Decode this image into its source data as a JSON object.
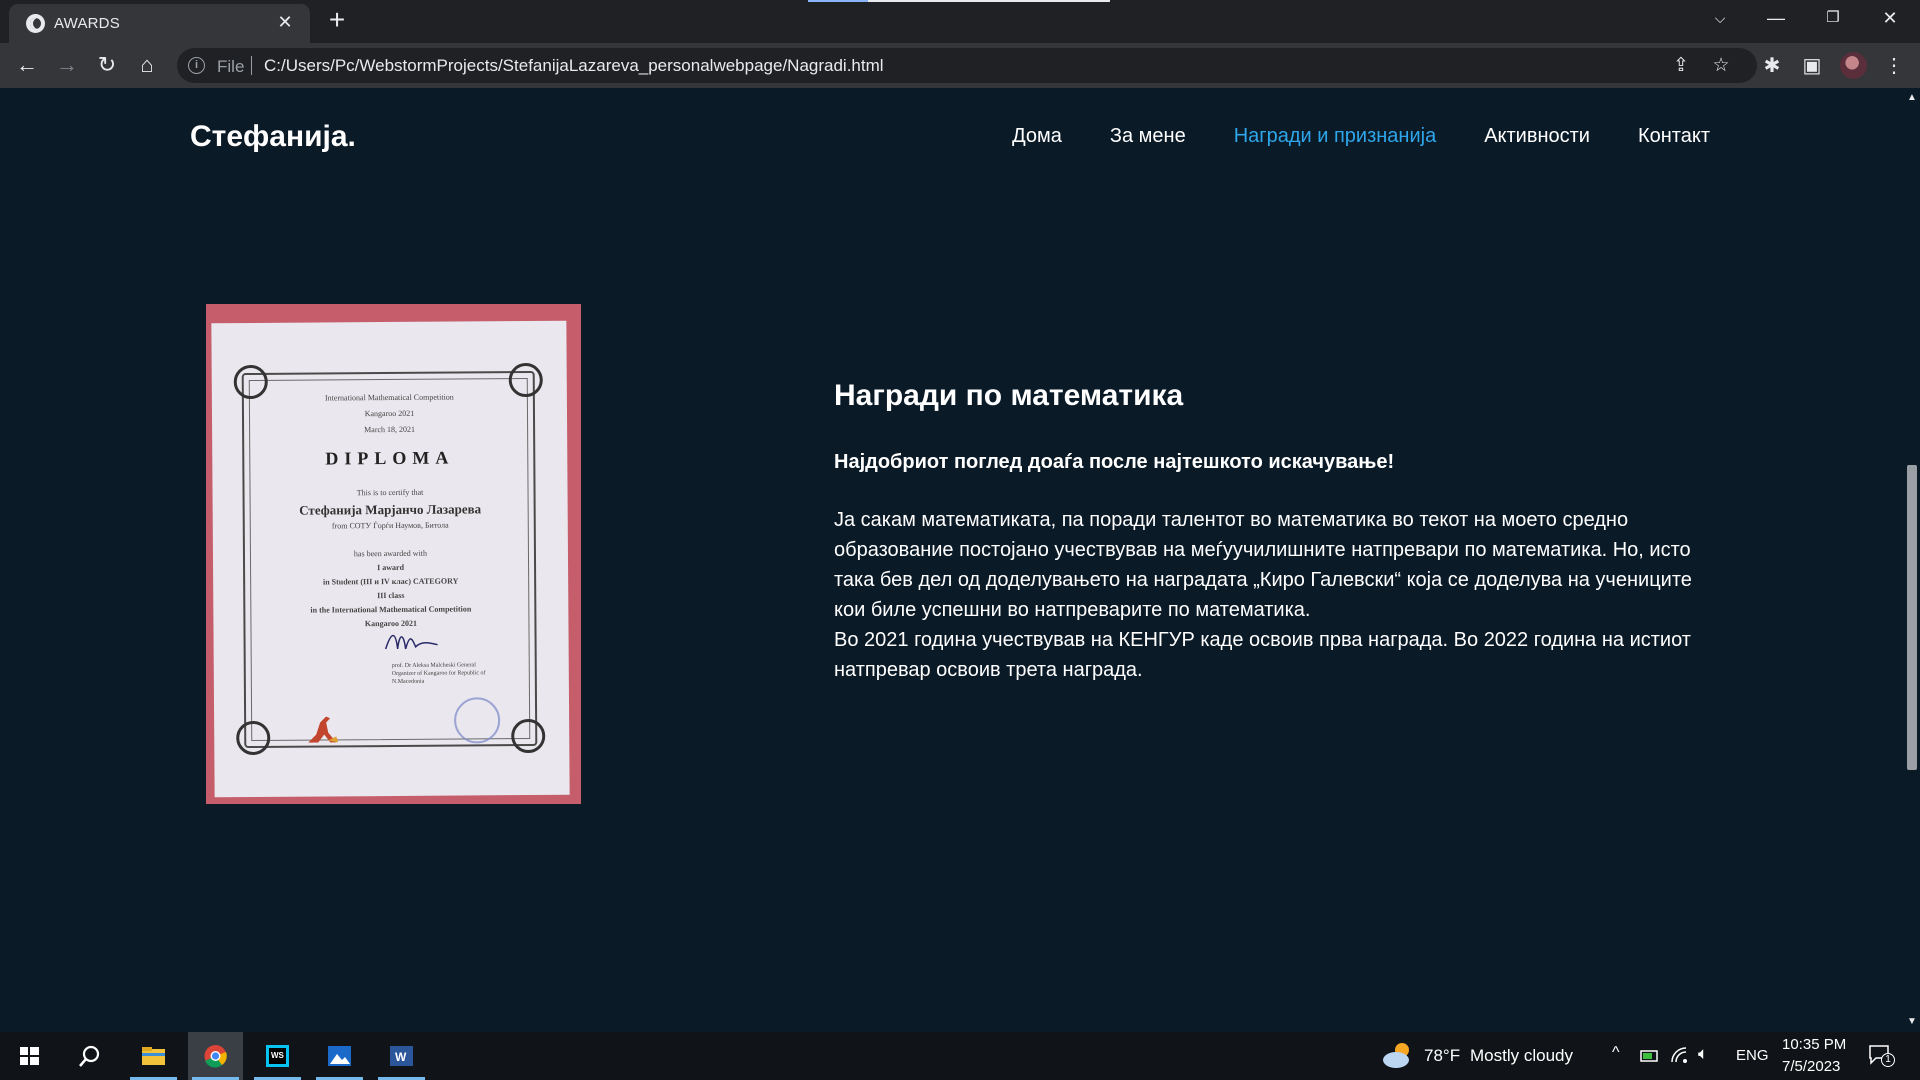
{
  "browser": {
    "tab_title": "AWARDS",
    "scheme_label": "File",
    "url": "C:/Users/Pc/WebstormProjects/StefanijaLazareva_personalwebpage/Nagradi.html"
  },
  "site": {
    "brand": "Стефанија.",
    "nav": [
      {
        "label": "Дома"
      },
      {
        "label": "За мене"
      },
      {
        "label": "Награди и признанија",
        "active": true
      },
      {
        "label": "Активности"
      },
      {
        "label": "Контакт"
      }
    ],
    "accent_color": "#2ea6ec",
    "background_color": "#0b1a27"
  },
  "diploma": {
    "line1": "International Mathematical Competition",
    "line2": "Kangaroo 2021",
    "line3": "March 18, 2021",
    "heading": "DIPLOMA",
    "certify": "This is to certify that",
    "name": "Стефанија Марјанчо Лазарева",
    "school": "from СОТУ Ѓорѓи Наумов, Битола",
    "awarded": "has been awarded with",
    "award": "I award",
    "category": "in Student (III и IV клас) CATEGORY",
    "class": "III class",
    "competition": "in the International Mathematical Competition",
    "year": "Kangaroo 2021",
    "signature": "prof. Dr Aleksa Malcheski General Organizer of Kangaroo for Republic of N.Macedonia"
  },
  "article": {
    "title": "Награди по математика",
    "quote": "Најдобриот поглед доаѓа после најтешкото искачување!",
    "lines": [
      "Ја сакам математиката, па поради талентот во математика во текот на моето средно",
      "образование постојано учествував на меѓуучилишните натпревари по математика. Но, исто",
      "така бев дел од доделувањето на наградата „Киро Галевски“ која се доделува на учениците",
      "кои биле успешни во натпреварите по математика.",
      "Во 2021 година учествував на КЕНГУР каде освоив прва награда. Во 2022 година на истиот",
      "натпревар освоив трета награда."
    ]
  },
  "taskbar": {
    "weather_temp": "78°F",
    "weather_text": "Mostly cloudy",
    "language": "ENG",
    "time": "10:35 PM",
    "date": "7/5/2023",
    "notification_count": "1"
  }
}
